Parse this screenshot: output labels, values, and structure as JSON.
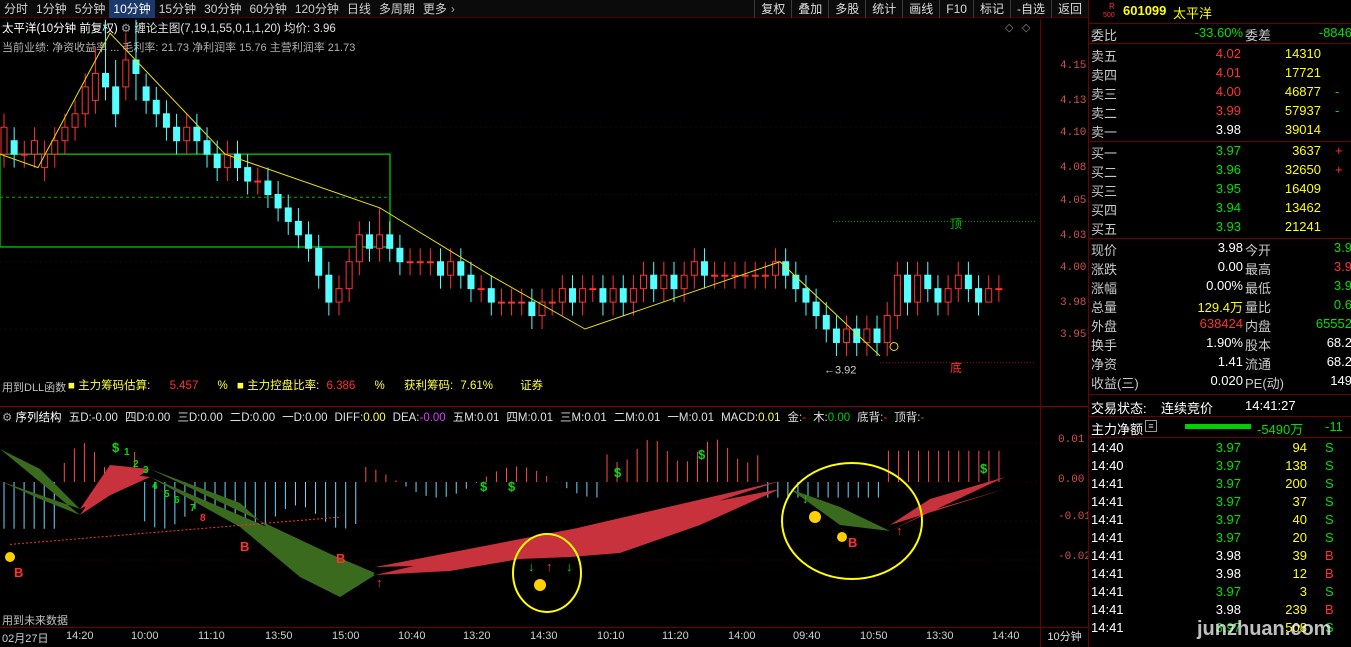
{
  "toolbar": {
    "periods": [
      "分时",
      "1分钟",
      "5分钟",
      "10分钟",
      "15分钟",
      "30分钟",
      "60分钟",
      "120分钟",
      "日线",
      "多周期",
      "更多"
    ],
    "active_index": 3,
    "buttons": [
      "复权",
      "叠加",
      "多股",
      "统计",
      "画线",
      "F10",
      "标记",
      "-自选",
      "返回"
    ]
  },
  "main_chart": {
    "title": "太平洋(10分钟 前复权)",
    "indicator": "缠论主图(7,19,1,55,0,1,1,20)",
    "avg_price": "均价: 3.96",
    "perf": "当前业绩: 净资收益率 ... 毛利率: 21.73 净利润率 15.76 主营利润率 21.73",
    "price_axis": [
      "4.15",
      "4.13",
      "4.10",
      "4.08",
      "4.05",
      "4.03",
      "4.00",
      "3.98",
      "3.95"
    ],
    "top_label": "顶",
    "bottom_label": "底",
    "low_mark": "3.92",
    "dll_label": "用到DLL函数",
    "main_est_label": "主力筹码估算:",
    "main_est_value": "5.457",
    "pct1": "%",
    "control_label": "主力控盘比率:",
    "control_value": "6.386",
    "pct2": "%",
    "profit_label": "获利筹码:",
    "profit_value": "7.61%",
    "sector": "证券"
  },
  "sub_chart": {
    "title": "序列结构",
    "values": [
      {
        "label": "五D:",
        "value": "-0.00",
        "color": "#e0e0e0"
      },
      {
        "label": "四D:",
        "value": "0.00",
        "color": "#e0e0e0"
      },
      {
        "label": "三D:",
        "value": "0.00",
        "color": "#e0e0e0"
      },
      {
        "label": "二D:",
        "value": "0.00",
        "color": "#e0e0e0"
      },
      {
        "label": "一D:",
        "value": "0.00",
        "color": "#e0e0e0"
      },
      {
        "label": "DIFF:",
        "value": "0.00",
        "color": "#ffff40"
      },
      {
        "label": "DEA:",
        "value": "-0.00",
        "color": "#d040ff"
      },
      {
        "label": "五M:",
        "value": "0.01",
        "color": "#e0e0e0"
      },
      {
        "label": "四M:",
        "value": "0.01",
        "color": "#e0e0e0"
      },
      {
        "label": "三M:",
        "value": "0.01",
        "color": "#e0e0e0"
      },
      {
        "label": "二M:",
        "value": "0.01",
        "color": "#e0e0e0"
      },
      {
        "label": "一M:",
        "value": "0.01",
        "color": "#e0e0e0"
      },
      {
        "label": "MACD:",
        "value": "0.01",
        "color": "#ffff40"
      },
      {
        "label": "金:",
        "value": "-",
        "color": "#ff3030"
      },
      {
        "label": "木:",
        "value": "0.00",
        "color": "#00d000"
      },
      {
        "label": "底背:",
        "value": "-",
        "color": "#ff3030"
      },
      {
        "label": "顶背:",
        "value": "-",
        "color": "#00c000"
      }
    ],
    "axis": [
      "0.01",
      "0.00",
      "-0.01",
      "-0.02"
    ],
    "future_label": "用到未来数据"
  },
  "time_axis": {
    "labels": [
      "02月27日",
      "14:20",
      "10:00",
      "11:10",
      "13:50",
      "15:00",
      "10:40",
      "13:20",
      "14:30",
      "10:10",
      "11:20",
      "14:00",
      "09:40",
      "10:50",
      "13:30",
      "14:40"
    ],
    "period": "10分钟"
  },
  "quote": {
    "code": "601099",
    "name": "太平洋",
    "r_badge": "R",
    "num_badge": "500",
    "weibi_label": "委比",
    "weibi_value": "-33.60%",
    "weicha_label": "委差",
    "weicha_value": "-8846",
    "asks": [
      {
        "label": "卖五",
        "price": "4.02",
        "vol": "14310",
        "chg": ""
      },
      {
        "label": "卖四",
        "price": "4.01",
        "vol": "17721",
        "chg": ""
      },
      {
        "label": "卖三",
        "price": "4.00",
        "vol": "46877",
        "chg": "-"
      },
      {
        "label": "卖二",
        "price": "3.99",
        "vol": "57937",
        "chg": "-"
      },
      {
        "label": "卖一",
        "price": "3.98",
        "vol": "39014",
        "chg": ""
      }
    ],
    "bids": [
      {
        "label": "买一",
        "price": "3.97",
        "vol": "3637",
        "chg": "+"
      },
      {
        "label": "买二",
        "price": "3.96",
        "vol": "32650",
        "chg": "+"
      },
      {
        "label": "买三",
        "price": "3.95",
        "vol": "16409",
        "chg": ""
      },
      {
        "label": "买四",
        "price": "3.94",
        "vol": "13462",
        "chg": ""
      },
      {
        "label": "买五",
        "price": "3.93",
        "vol": "21241",
        "chg": ""
      }
    ],
    "stats": [
      {
        "l1": "现价",
        "v1": "3.98",
        "c1": "white",
        "l2": "今开",
        "v2": "3.9",
        "c2": "green"
      },
      {
        "l1": "涨跌",
        "v1": "0.00",
        "c1": "white",
        "l2": "最高",
        "v2": "3.9",
        "c2": "red"
      },
      {
        "l1": "涨幅",
        "v1": "0.00%",
        "c1": "white",
        "l2": "最低",
        "v2": "3.9",
        "c2": "green"
      },
      {
        "l1": "总量",
        "v1": "129.4万",
        "c1": "yellow",
        "l2": "量比",
        "v2": "0.6",
        "c2": "green"
      },
      {
        "l1": "外盘",
        "v1": "638424",
        "c1": "red",
        "l2": "内盘",
        "v2": "65552",
        "c2": "green"
      },
      {
        "l1": "换手",
        "v1": "1.90%",
        "c1": "white",
        "l2": "股本",
        "v2": "68.2",
        "c2": "white"
      },
      {
        "l1": "净资",
        "v1": "1.41",
        "c1": "white",
        "l2": "流通",
        "v2": "68.2",
        "c2": "white"
      },
      {
        "l1": "收益(三)",
        "v1": "0.020",
        "c1": "white",
        "l2": "PE(动)",
        "v2": "149",
        "c2": "white"
      }
    ],
    "trade_status_label": "交易状态:",
    "trade_status": "连续竞价",
    "trade_time": "14:41:27",
    "net_flow_label": "主力净额",
    "net_flow_value": "-5490万",
    "net_flow_extra": "-11",
    "ticks": [
      {
        "t": "14:40",
        "p": "3.97",
        "v": "94",
        "s": "S"
      },
      {
        "t": "14:40",
        "p": "3.97",
        "v": "138",
        "s": "S"
      },
      {
        "t": "14:41",
        "p": "3.97",
        "v": "200",
        "s": "S"
      },
      {
        "t": "14:41",
        "p": "3.97",
        "v": "37",
        "s": "S"
      },
      {
        "t": "14:41",
        "p": "3.97",
        "v": "40",
        "s": "S"
      },
      {
        "t": "14:41",
        "p": "3.97",
        "v": "20",
        "s": "S"
      },
      {
        "t": "14:41",
        "p": "3.98",
        "v": "39",
        "s": "B"
      },
      {
        "t": "14:41",
        "p": "3.98",
        "v": "12",
        "s": "B"
      },
      {
        "t": "14:41",
        "p": "3.97",
        "v": "3",
        "s": "S"
      },
      {
        "t": "14:41",
        "p": "3.98",
        "v": "239",
        "s": "B"
      },
      {
        "t": "14:41",
        "p": "3.97",
        "v": "508",
        "s": "S"
      }
    ],
    "watermark": "junzhuan.com"
  },
  "colors": {
    "up": "#ff3232",
    "down": "#54ffff",
    "yellow_line": "#e8e000",
    "green_box": "#00b000",
    "green_band": "#3a6a1e",
    "red_band": "#c8323c"
  }
}
